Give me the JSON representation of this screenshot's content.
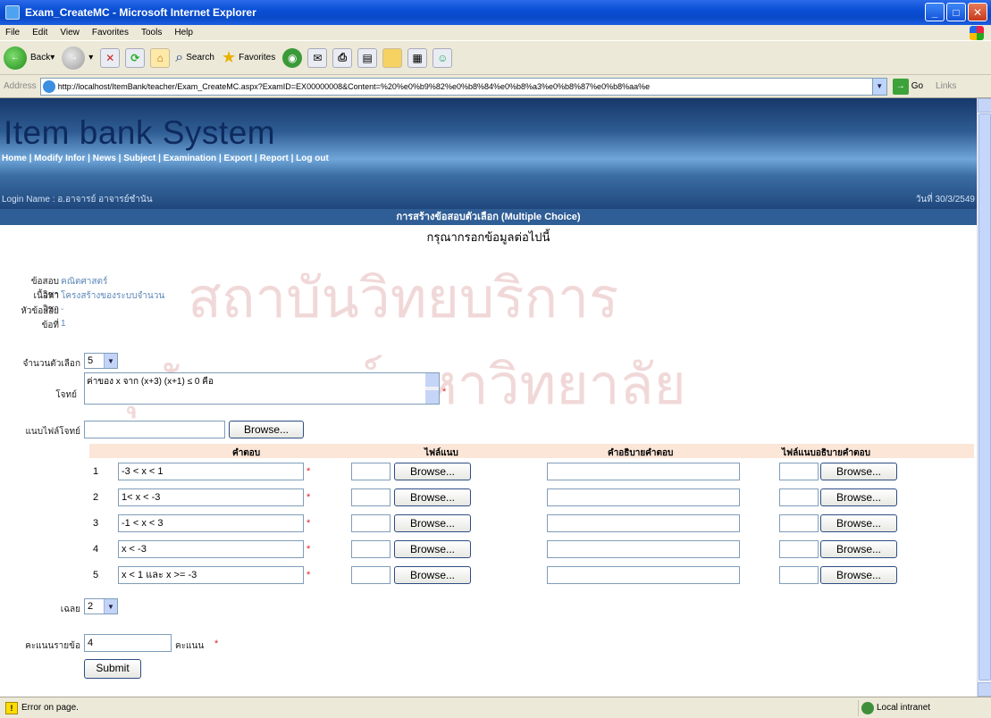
{
  "window": {
    "title": "Exam_CreateMC - Microsoft Internet Explorer",
    "min": "_",
    "max": "□",
    "close": "✕"
  },
  "menu": [
    "File",
    "Edit",
    "View",
    "Favorites",
    "Tools",
    "Help"
  ],
  "toolbar": {
    "back": "Back",
    "search": "Search",
    "favorites": "Favorites"
  },
  "address": {
    "label": "Address",
    "url": "http://localhost/ItemBank/teacher/Exam_CreateMC.aspx?ExamID=EX00000008&Content=%20%e0%b9%82%e0%b8%84%e0%b8%a3%e0%b8%87%e0%b8%aa%e",
    "go": "Go",
    "links": "Links"
  },
  "banner": {
    "title": "Item bank System",
    "nav": [
      "Home",
      "Modify Infor",
      "News",
      "Subject",
      "Examination",
      "Export",
      "Report",
      "Log out"
    ],
    "login": "Login Name : อ.อาจารย์ อาจารย์ชำนัน",
    "date": "วันที่ 30/3/2549"
  },
  "page": {
    "subhead": "การสร้างข้อสอบตัวเลือก (Multiple Choice)",
    "instruction": "กรุณากรอกข้อมูลต่อไปนี้",
    "watermark1": "สถาบันวิทยบริการ",
    "watermark2": "จุฬาลงกรณ์มหาวิทยาลัย"
  },
  "fields": {
    "subject_label": "ข้อสอบวิชา",
    "subject_value": "คณิตศาสตร์",
    "topic_label": "เนื้อหาวิชา",
    "topic_value": "โครงสร้างของระบบจำนวน",
    "subtopic_label": "หัวข้อย่อย",
    "subtopic_value": "-",
    "number_label": "ข้อที่",
    "number_value": "1",
    "choices_label": "จำนวนตัวเลือก",
    "choices_value": "5",
    "question_label": "โจทย์",
    "question_value": "ค่าของ x จาก (x+3) (x+1) ≤ 0 คือ",
    "attach_label": "แนบไฟล์โจทย์",
    "browse": "Browse...",
    "answer_label": "เฉลย",
    "answer_value": "2",
    "score_label": "คะแนนรายข้อ",
    "score_value": "4",
    "score_unit": "คะแนน",
    "submit": "Submit",
    "required": "*"
  },
  "table": {
    "headers": [
      "คำตอบ",
      "ไฟล์แนบ",
      "คำอธิบายคำตอบ",
      "ไฟล์แนบอธิบายคำตอบ"
    ],
    "rows": [
      {
        "num": "1",
        "answer": "-3 < x < 1"
      },
      {
        "num": "2",
        "answer": "1< x < -3"
      },
      {
        "num": "3",
        "answer": "-1 < x < 3"
      },
      {
        "num": "4",
        "answer": "x < -3"
      },
      {
        "num": "5",
        "answer": "x < 1 และ x >= -3"
      }
    ]
  },
  "status": {
    "text": "Error on page.",
    "zone": "Local intranet"
  }
}
